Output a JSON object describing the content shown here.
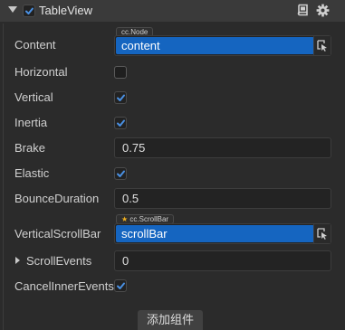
{
  "header": {
    "title": "TableView",
    "enabled": true
  },
  "properties": {
    "content": {
      "label": "Content",
      "type_tag": "cc.Node",
      "value": "content"
    },
    "horizontal": {
      "label": "Horizontal",
      "checked": false
    },
    "vertical": {
      "label": "Vertical",
      "checked": true
    },
    "inertia": {
      "label": "Inertia",
      "checked": true
    },
    "brake": {
      "label": "Brake",
      "value": "0.75"
    },
    "elastic": {
      "label": "Elastic",
      "checked": true
    },
    "bounce_duration": {
      "label": "BounceDuration",
      "value": "0.5"
    },
    "vertical_scrollbar": {
      "label": "VerticalScrollBar",
      "type_tag": "cc.ScrollBar",
      "value": "scrollBar"
    },
    "scroll_events": {
      "label": "ScrollEvents",
      "value": "0"
    },
    "cancel_inner_events": {
      "label": "CancelInnerEvents",
      "checked": true
    }
  },
  "add_component_label": "添加组件",
  "colors": {
    "panel_bg": "#2b2b2b",
    "header_bg": "#3a3a3a",
    "field_bg": "#232323",
    "object_field_selected": "#1565c0",
    "checkmark": "#4a90e2",
    "type_tag_star": "#f0b020"
  },
  "icons": {
    "fold": "triangle-down",
    "help": "book-icon",
    "settings": "gear-icon",
    "picker": "object-picker-icon",
    "expand": "triangle-right"
  }
}
